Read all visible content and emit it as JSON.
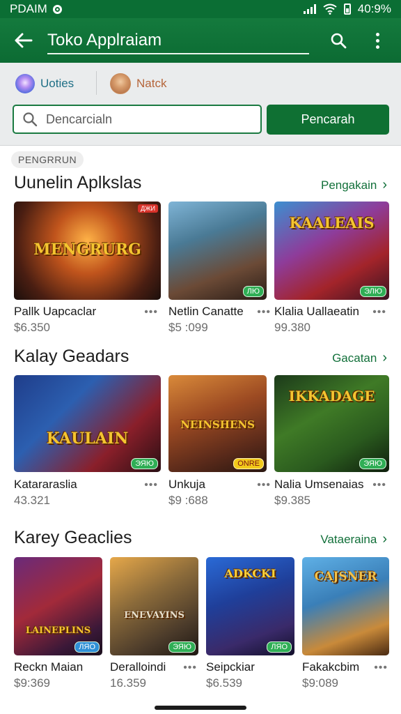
{
  "status": {
    "carrier": "PDAIM",
    "battery": "40:9%"
  },
  "appbar": {
    "title": "Toko Applraiam"
  },
  "chips": [
    {
      "label": "Uoties"
    },
    {
      "label": "Natck"
    }
  ],
  "search": {
    "placeholder": "Dencarcialn",
    "button": "Pencarah"
  },
  "colors": {
    "primary": "#0f7033",
    "accent": "#12703a",
    "background": "#ffffff"
  },
  "sections": [
    {
      "pill": "PENGRRUN",
      "title": "Uunelin Aplkslas",
      "link": "Pengakain",
      "cards": [
        {
          "art": "MENGRURG",
          "name": "Pallk Uapcaclar",
          "price": "$6.350",
          "badge_top": "ДЖИ",
          "badge": ""
        },
        {
          "art": "",
          "name": "Netlin Canatte",
          "price": "$5 :099",
          "badge_top": "",
          "badge": "ЛЮ"
        },
        {
          "art": "KAALEAIS",
          "name": "Klalia Uallaeatin",
          "price": "99.380",
          "badge_top": "",
          "badge": "ЭЛЮ"
        }
      ]
    },
    {
      "title": "Kalay Geadars",
      "link": "Gacatan",
      "cards": [
        {
          "art": "KAULAIN",
          "name": "Katararaslia",
          "price": "43.321",
          "badge_top": "",
          "badge": "ЭЯЮ"
        },
        {
          "art": "NEINSHENS",
          "name": "Unkuja",
          "price": "$9 :688",
          "badge_top": "",
          "badge": "ONRE"
        },
        {
          "art": "IKKADAGE",
          "name": "Nalia Umsenaias",
          "price": "$9.385",
          "badge_top": "",
          "badge": "ЭЯЮ"
        }
      ]
    },
    {
      "title": "Karey Geaclies",
      "link": "Vataeraina",
      "cards": [
        {
          "art": "LAINEPLINS",
          "name": "Reckn Maian",
          "price": "$9:369",
          "badge_top": "",
          "badge": "ЛЯО"
        },
        {
          "art": "ENEVAYINS",
          "name": "Deralloindi",
          "price": "16.359",
          "badge_top": "",
          "badge": "ЭЯЮ"
        },
        {
          "art": "ADKCKI",
          "name": "Seipckiar",
          "price": "$6.539",
          "badge_top": "",
          "badge": "ЛЯО"
        },
        {
          "art": "CAJSNER",
          "name": "Fakakcbim",
          "price": "$9:089",
          "badge_top": "",
          "badge": ""
        }
      ]
    }
  ]
}
